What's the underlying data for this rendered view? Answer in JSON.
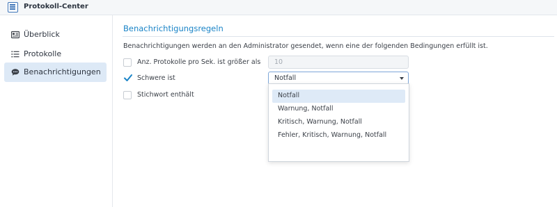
{
  "app": {
    "title": "Protokoll-Center",
    "icon": "log-center-icon"
  },
  "sidebar": {
    "items": [
      {
        "label": "Überblick",
        "icon": "overview-icon",
        "active": false
      },
      {
        "label": "Protokolle",
        "icon": "list-icon",
        "active": false
      },
      {
        "label": "Benachrichtigungen",
        "icon": "chat-bubble-icon",
        "active": true
      }
    ]
  },
  "main": {
    "section_title": "Benachrichtigungsregeln",
    "description": "Benachrichtigungen werden an den Administrator gesendet, wenn eine der folgenden Bedingungen erfüllt ist.",
    "rules": [
      {
        "label": "Anz. Protokolle pro Sek. ist größer als",
        "checked": false,
        "value": "10",
        "disabled": true
      },
      {
        "label": "Schwere ist",
        "checked": true,
        "value": "Notfall"
      },
      {
        "label": "Stichwort enthält",
        "checked": false
      }
    ],
    "severity_options": [
      "Notfall",
      "Warnung, Notfall",
      "Kritisch, Warnung, Notfall",
      "Fehler, Kritisch, Warnung, Notfall"
    ],
    "selected_option_index": 0
  },
  "colors": {
    "accent": "#1a84c7",
    "selection": "#deeaf7",
    "active_nav": "#dde9f6"
  }
}
